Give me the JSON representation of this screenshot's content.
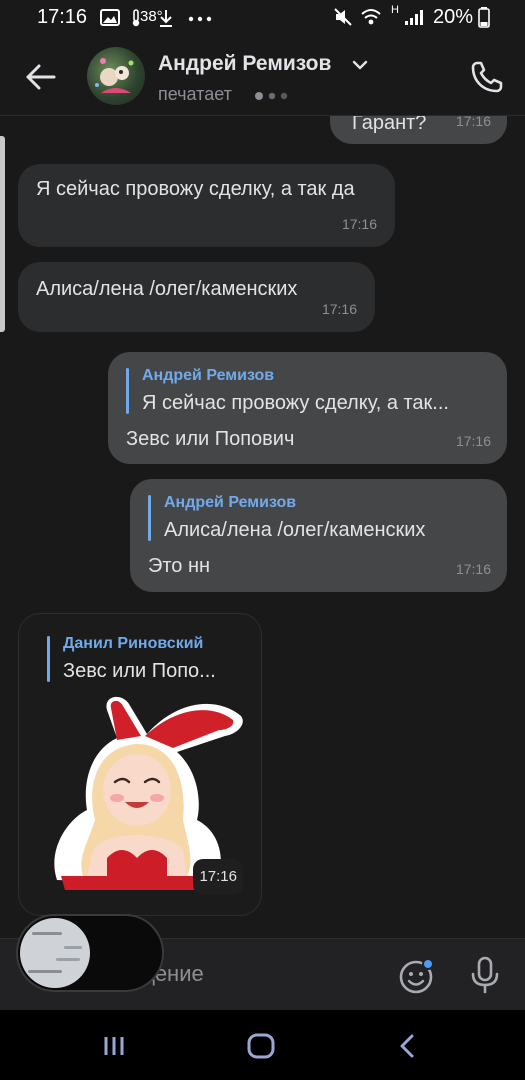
{
  "status_bar": {
    "time": "17:16",
    "temperature": "38°",
    "network": "H",
    "battery": "20%"
  },
  "header": {
    "contact_name": "Андрей Ремизов",
    "contact_status": "печатает"
  },
  "messages": [
    {
      "text": "Гарант?",
      "time": "17:16"
    },
    {
      "text": "Я сейчас провожу сделку, а так да",
      "time": "17:16"
    },
    {
      "text": "Алиса/лена /олег/каменских",
      "time": "17:16"
    },
    {
      "reply_author": "Андрей Ремизов",
      "reply_text": "Я сейчас провожу сделку, а так...",
      "text": "Зевс или Попович",
      "time": "17:16"
    },
    {
      "reply_author": "Андрей Ремизов",
      "reply_text": "Алиса/лена /олег/каменских",
      "text": "Это нн",
      "time": "17:16"
    },
    {
      "reply_author": "Данил Риновский",
      "reply_text": "Зевс или Попо...",
      "sticker": "bunny-girl-sticker",
      "time": "17:16"
    }
  ],
  "composer": {
    "placeholder": "Сообщение"
  },
  "icons": {
    "back": "arrow-left-icon",
    "chevron": "chevron-down-icon",
    "call": "phone-icon",
    "emoji": "smile-icon",
    "mic": "microphone-icon",
    "nav_recents": "recents-icon",
    "nav_home": "home-icon",
    "nav_back": "nav-back-icon"
  },
  "colors": {
    "background": "#19191a",
    "incoming_bubble": "#2c2d2e",
    "outgoing_bubble": "#454647",
    "accent": "#71aaeb",
    "badge": "#4a9df8"
  }
}
